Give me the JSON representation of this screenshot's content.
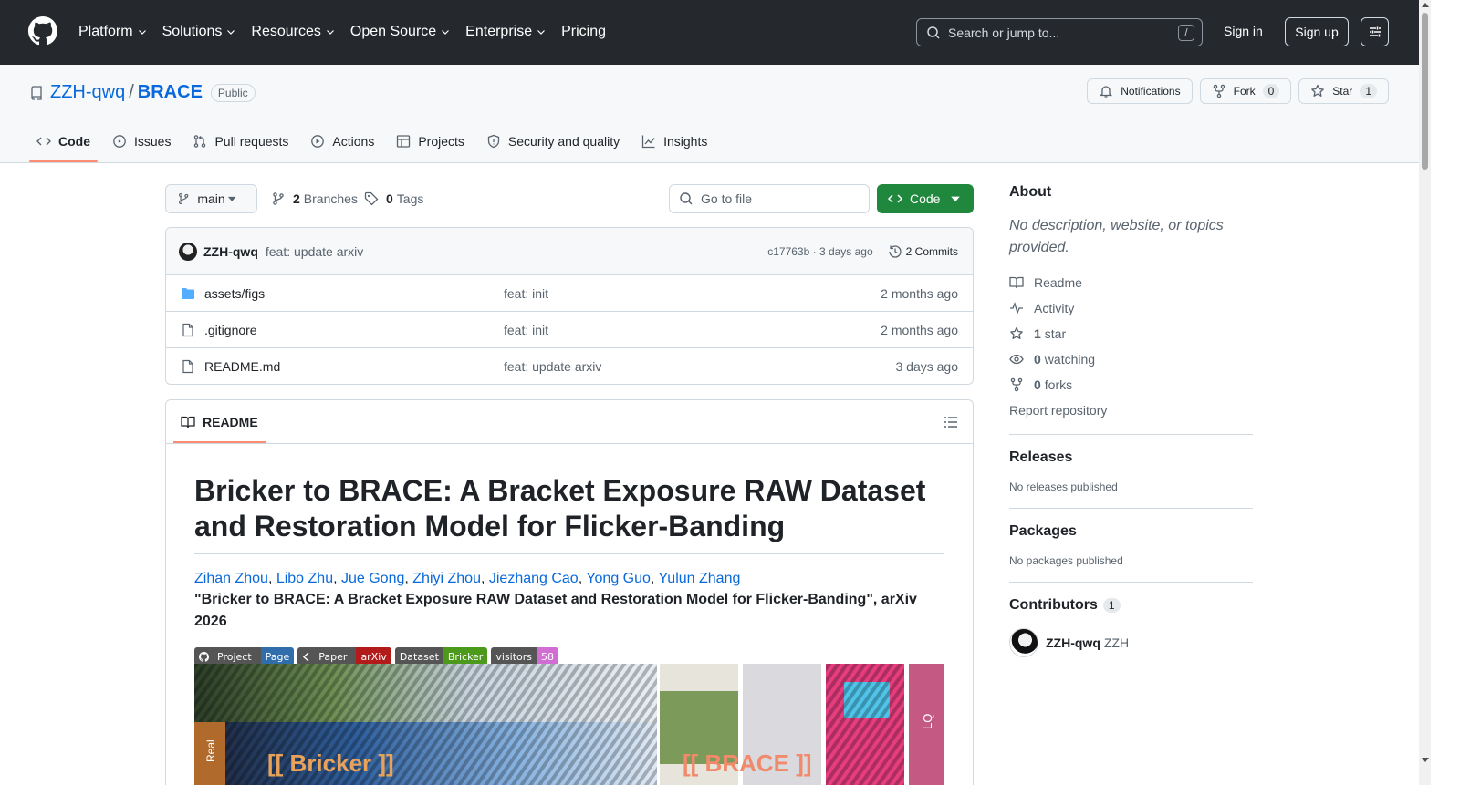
{
  "header": {
    "nav": [
      "Platform",
      "Solutions",
      "Resources",
      "Open Source",
      "Enterprise",
      "Pricing"
    ],
    "search_placeholder": "Search or jump to...",
    "search_shortcut": "/",
    "signin": "Sign in",
    "signup": "Sign up"
  },
  "repo": {
    "owner": "ZZH-qwq",
    "sep": "/",
    "name": "BRACE",
    "visibility": "Public",
    "notifications": "Notifications",
    "fork": "Fork",
    "fork_count": "0",
    "star": "Star",
    "star_count": "1"
  },
  "tabs": [
    "Code",
    "Issues",
    "Pull requests",
    "Actions",
    "Projects",
    "Security and quality",
    "Insights"
  ],
  "toolbar": {
    "branch": "main",
    "branches_count": "2",
    "branches_label": "Branches",
    "tags_count": "0",
    "tags_label": "Tags",
    "goto_placeholder": "Go to file",
    "code_button": "Code"
  },
  "commit": {
    "user": "ZZH-qwq",
    "message": "feat: update arxiv",
    "hash_time": "c17763b · 3 days ago",
    "commits": "2 Commits"
  },
  "files": [
    {
      "type": "folder",
      "name": "assets/figs",
      "message": "feat: init",
      "date": "2 months ago"
    },
    {
      "type": "file",
      "name": ".gitignore",
      "message": "feat: init",
      "date": "2 months ago"
    },
    {
      "type": "file",
      "name": "README.md",
      "message": "feat: update arxiv",
      "date": "3 days ago"
    }
  ],
  "readme": {
    "tab": "README",
    "title": "Bricker to BRACE: A Bracket Exposure RAW Dataset and Restoration Model for Flicker-Banding",
    "authors": [
      "Zihan Zhou",
      "Libo Zhu",
      "Jue Gong",
      "Zhiyi Zhou",
      "Jiezhang Cao",
      "Yong Guo",
      "Yulun Zhang"
    ],
    "author_sep": ", ",
    "venue": "\"Bricker to BRACE: A Bracket Exposure RAW Dataset and Restoration Model for Flicker-Banding\", arXiv 2026",
    "shields": [
      {
        "label": "Project",
        "value": "Page",
        "color": "#2f6eaa"
      },
      {
        "label": "Paper",
        "value": "arXiv",
        "color": "#b31b1b"
      },
      {
        "label": "Dataset",
        "value": "Bricker",
        "color": "#4c9a1c"
      },
      {
        "label": "visitors",
        "value": "58",
        "color": "#d26dd4"
      }
    ],
    "banner_real": "Real",
    "banner_left": "[[ Bricker ]]",
    "banner_right": "[[ BRACE ]]",
    "banner_lq": "LQ"
  },
  "sidebar": {
    "about": "About",
    "description": "No description, website, or topics provided.",
    "readme": "Readme",
    "activity": "Activity",
    "stars_n": "1",
    "stars_label": "star",
    "watching_n": "0",
    "watching_label": "watching",
    "forks_n": "0",
    "forks_label": "forks",
    "report": "Report repository",
    "releases": "Releases",
    "releases_none": "No releases published",
    "packages": "Packages",
    "packages_none": "No packages published",
    "contributors": "Contributors",
    "contributors_count": "1",
    "contributor_login": "ZZH-qwq",
    "contributor_name": "ZZH"
  }
}
